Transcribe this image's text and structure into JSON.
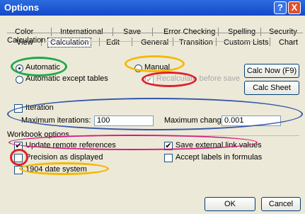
{
  "window": {
    "title": "Options",
    "help": "?",
    "close": "X"
  },
  "tabs_row1": [
    "Color",
    "International",
    "Save",
    "Error Checking",
    "Spelling",
    "Security"
  ],
  "tabs_row2": [
    "View",
    "Calculation",
    "Edit",
    "General",
    "Transition",
    "Custom Lists",
    "Chart"
  ],
  "calc": {
    "title": "Calculation",
    "automatic": "Automatic",
    "automatic_except": "Automatic except tables",
    "manual": "Manual",
    "recalc": "Recalculate before save",
    "calc_now": "Calc Now (F9)",
    "calc_sheet": "Calc Sheet"
  },
  "iteration": {
    "label": "Iteration",
    "max_iter_label": "Maximum iterations:",
    "max_iter_value": "100",
    "max_change_label": "Maximum change:",
    "max_change_value": "0.001"
  },
  "workbook": {
    "title": "Workbook options",
    "update_remote": "Update remote references",
    "precision": "Precision as displayed",
    "date1904": "1904 date system",
    "save_ext": "Save external link values",
    "accept_labels": "Accept labels in formulas"
  },
  "footer": {
    "ok": "OK",
    "cancel": "Cancel"
  },
  "colors": {
    "green": "#1fa84a",
    "yellow": "#f5b800",
    "red": "#e0202a",
    "blue": "#3355aa",
    "magenta": "#d6197e"
  }
}
